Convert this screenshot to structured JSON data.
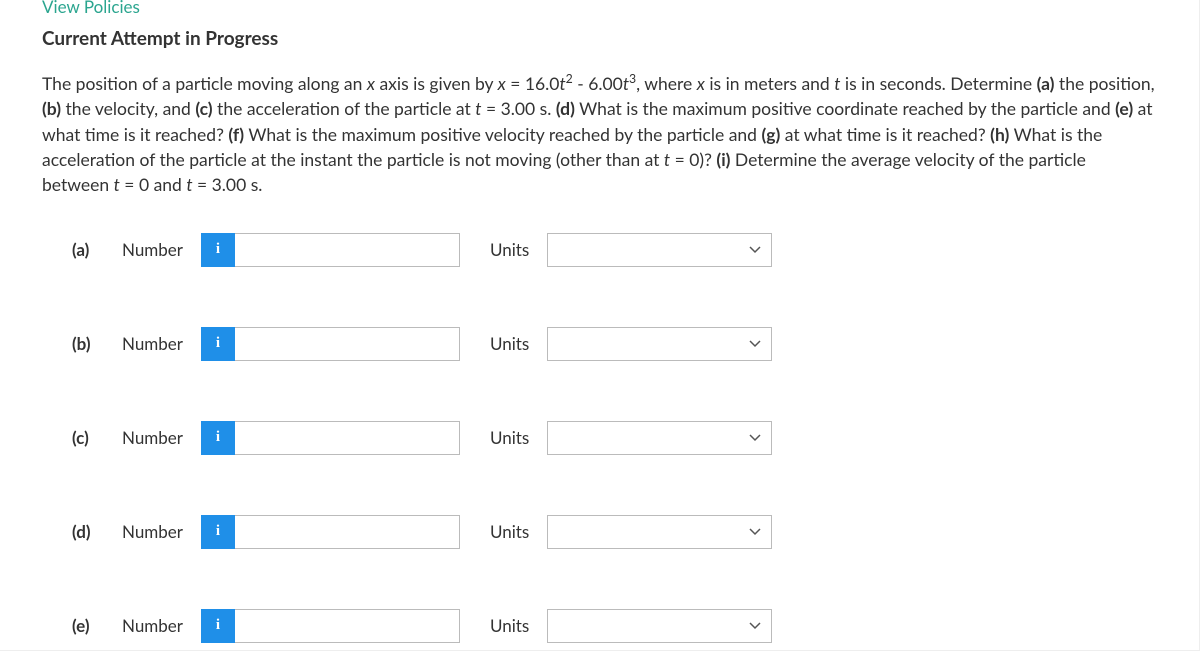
{
  "header": {
    "view_policies": "View Policies",
    "attempt": "Current Attempt in Progress"
  },
  "question": {
    "pre_eq": "The position of a particle moving along an ",
    "x_var": "x",
    "mid1": " axis is given by ",
    "eq_lhs": "x",
    "eq_eq": " = 16.0",
    "eq_t": "t",
    "eq_sq": "2",
    "eq_minus": " - 6.00",
    "eq_t2": "t",
    "eq_cube": "3",
    "eq_after": ", where ",
    "x_var2": "x",
    "mid2": " is in meters and ",
    "t_var": "t",
    "mid3": " is in seconds. Determine ",
    "pa": "(a)",
    "ta": " the position, ",
    "pb": "(b)",
    "tb": " the velocity, and ",
    "pc": "(c)",
    "tc": " the acceleration of the particle at ",
    "t_eq": "t",
    "t_val": " = 3.00 s. ",
    "pd": "(d)",
    "td": " What is the maximum positive coordinate reached by the particle and ",
    "pe": "(e)",
    "te": " at what time is it reached? ",
    "pf": "(f)",
    "tf": " What is the maximum positive velocity reached by the particle and ",
    "pg": "(g)",
    "tg": " at what time is it reached? ",
    "ph": "(h)",
    "th": " What is the acceleration of the particle at the instant the particle is not moving (other than at ",
    "t_zero": "t",
    "t_zero_val": " = 0)? ",
    "pi": "(i)",
    "ti": " Determine the average velocity of the particle between ",
    "t_range1": "t",
    "t_range_mid": " = 0 and ",
    "t_range2": "t",
    "t_range_end": " = 3.00 s."
  },
  "labels": {
    "number": "Number",
    "units": "Units",
    "info": "i"
  },
  "parts": [
    {
      "id": "(a)"
    },
    {
      "id": "(b)"
    },
    {
      "id": "(c)"
    },
    {
      "id": "(d)"
    },
    {
      "id": "(e)"
    }
  ]
}
